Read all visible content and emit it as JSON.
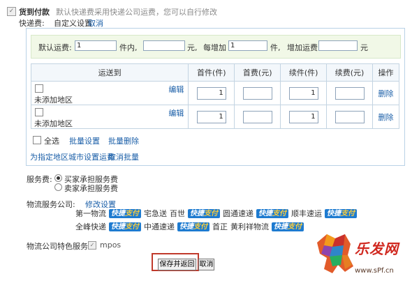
{
  "cod": {
    "label": "货到付款",
    "note": "默认快递费采用快递公司运费，您可以自行修改"
  },
  "express": {
    "label": "快递费:",
    "mode": "自定义设置",
    "cancel": "取消"
  },
  "default_fee": {
    "label_default": "默认运费:",
    "first_qty": "1",
    "unit_in": "件内,",
    "first_fee": "",
    "unit_yuan": "元,",
    "label_each_add": "每增加",
    "add_qty": "1",
    "unit_item": "件,",
    "label_add_fee": "增加运费",
    "add_fee": "",
    "unit_yuan2": "元"
  },
  "table": {
    "headers": [
      "运送到",
      "首件(件)",
      "首费(元)",
      "续件(件)",
      "续费(元)",
      "操作"
    ],
    "rows": [
      {
        "area": "未添加地区",
        "edit": "编辑",
        "first_qty": "1",
        "first_fee": "",
        "add_qty": "1",
        "add_fee": "",
        "op": "删除"
      },
      {
        "area": "未添加地区",
        "edit": "编辑",
        "first_qty": "1",
        "first_fee": "",
        "add_qty": "1",
        "add_fee": "",
        "op": "删除"
      }
    ]
  },
  "batch": {
    "select_all": "全选",
    "batch_set": "批量设置",
    "batch_delete": "批量删除",
    "city_fee": "为指定地区城市设置运费",
    "cancel_batch": "取消批量"
  },
  "service_fee": {
    "label": "服务费:",
    "option_buyer": "买家承担服务费",
    "option_seller": "卖家承担服务费"
  },
  "logistics": {
    "label": "物流服务公司:",
    "edit": "修改设置",
    "badge_a": "快捷",
    "badge_b": "支付",
    "row1": [
      "第一物流",
      "宅急送",
      "百世",
      "圆通速递",
      "顺丰速运"
    ],
    "row2": [
      "全峰快递",
      "中通速递",
      "首正",
      "黄利祥物流"
    ]
  },
  "feature": {
    "label": "物流公司特色服务:",
    "value": "mpos"
  },
  "actions": {
    "save": "保存并返回",
    "cancel": "取消"
  },
  "watermark": {
    "name": "乐发网",
    "url": "www.sPf.cn"
  },
  "colors": {
    "link": "#1b5fa8",
    "badge": "#1e7bd0",
    "highlight": "#c0392b"
  }
}
